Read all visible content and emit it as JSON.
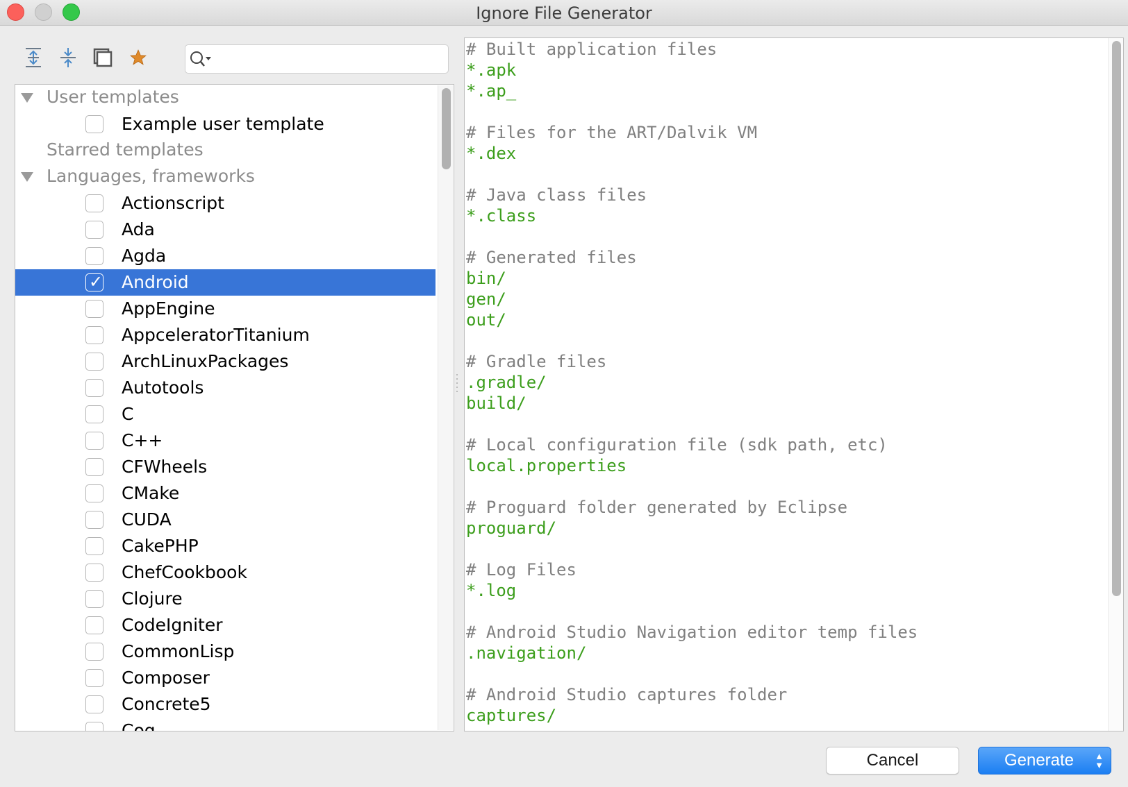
{
  "window": {
    "title": "Ignore File Generator"
  },
  "toolbar": {
    "buttons": [
      {
        "icon": "expand-all-icon"
      },
      {
        "icon": "collapse-all-icon"
      },
      {
        "icon": "unselect-all-icon"
      },
      {
        "icon": "star-icon"
      }
    ],
    "search": {
      "value": "",
      "placeholder": ""
    }
  },
  "tree": {
    "groups": [
      {
        "label": "User templates",
        "expanded": true,
        "items": [
          {
            "label": "Example user template",
            "checked": false
          }
        ]
      },
      {
        "label": "Starred templates",
        "expanded": false,
        "items": []
      },
      {
        "label": "Languages, frameworks",
        "expanded": true,
        "items": [
          {
            "label": "Actionscript",
            "checked": false
          },
          {
            "label": "Ada",
            "checked": false
          },
          {
            "label": "Agda",
            "checked": false
          },
          {
            "label": "Android",
            "checked": true,
            "selected": true
          },
          {
            "label": "AppEngine",
            "checked": false
          },
          {
            "label": "AppceleratorTitanium",
            "checked": false
          },
          {
            "label": "ArchLinuxPackages",
            "checked": false
          },
          {
            "label": "Autotools",
            "checked": false
          },
          {
            "label": "C",
            "checked": false
          },
          {
            "label": "C++",
            "checked": false
          },
          {
            "label": "CFWheels",
            "checked": false
          },
          {
            "label": "CMake",
            "checked": false
          },
          {
            "label": "CUDA",
            "checked": false
          },
          {
            "label": "CakePHP",
            "checked": false
          },
          {
            "label": "ChefCookbook",
            "checked": false
          },
          {
            "label": "Clojure",
            "checked": false
          },
          {
            "label": "CodeIgniter",
            "checked": false
          },
          {
            "label": "CommonLisp",
            "checked": false
          },
          {
            "label": "Composer",
            "checked": false
          },
          {
            "label": "Concrete5",
            "checked": false
          },
          {
            "label": "Coq",
            "checked": false
          }
        ]
      }
    ]
  },
  "preview": {
    "lines": [
      {
        "type": "comment",
        "text": "# Built application files"
      },
      {
        "type": "pattern",
        "text": "*.apk"
      },
      {
        "type": "pattern",
        "text": "*.ap_"
      },
      {
        "type": "blank",
        "text": ""
      },
      {
        "type": "comment",
        "text": "# Files for the ART/Dalvik VM"
      },
      {
        "type": "pattern",
        "text": "*.dex"
      },
      {
        "type": "blank",
        "text": ""
      },
      {
        "type": "comment",
        "text": "# Java class files"
      },
      {
        "type": "pattern",
        "text": "*.class"
      },
      {
        "type": "blank",
        "text": ""
      },
      {
        "type": "comment",
        "text": "# Generated files"
      },
      {
        "type": "pattern",
        "text": "bin/"
      },
      {
        "type": "pattern",
        "text": "gen/"
      },
      {
        "type": "pattern",
        "text": "out/"
      },
      {
        "type": "blank",
        "text": ""
      },
      {
        "type": "comment",
        "text": "# Gradle files"
      },
      {
        "type": "pattern",
        "text": ".gradle/"
      },
      {
        "type": "pattern",
        "text": "build/"
      },
      {
        "type": "blank",
        "text": ""
      },
      {
        "type": "comment",
        "text": "# Local configuration file (sdk path, etc)"
      },
      {
        "type": "pattern",
        "text": "local.properties"
      },
      {
        "type": "blank",
        "text": ""
      },
      {
        "type": "comment",
        "text": "# Proguard folder generated by Eclipse"
      },
      {
        "type": "pattern",
        "text": "proguard/"
      },
      {
        "type": "blank",
        "text": ""
      },
      {
        "type": "comment",
        "text": "# Log Files"
      },
      {
        "type": "pattern",
        "text": "*.log"
      },
      {
        "type": "blank",
        "text": ""
      },
      {
        "type": "comment",
        "text": "# Android Studio Navigation editor temp files"
      },
      {
        "type": "pattern",
        "text": ".navigation/"
      },
      {
        "type": "blank",
        "text": ""
      },
      {
        "type": "comment",
        "text": "# Android Studio captures folder"
      },
      {
        "type": "pattern",
        "text": "captures/"
      }
    ]
  },
  "buttons": {
    "cancel": "Cancel",
    "generate": "Generate"
  },
  "colors": {
    "selection": "#3875d7",
    "comment": "#808080",
    "pattern": "#3c9e1c",
    "primary_button": "#1b7ef2"
  }
}
